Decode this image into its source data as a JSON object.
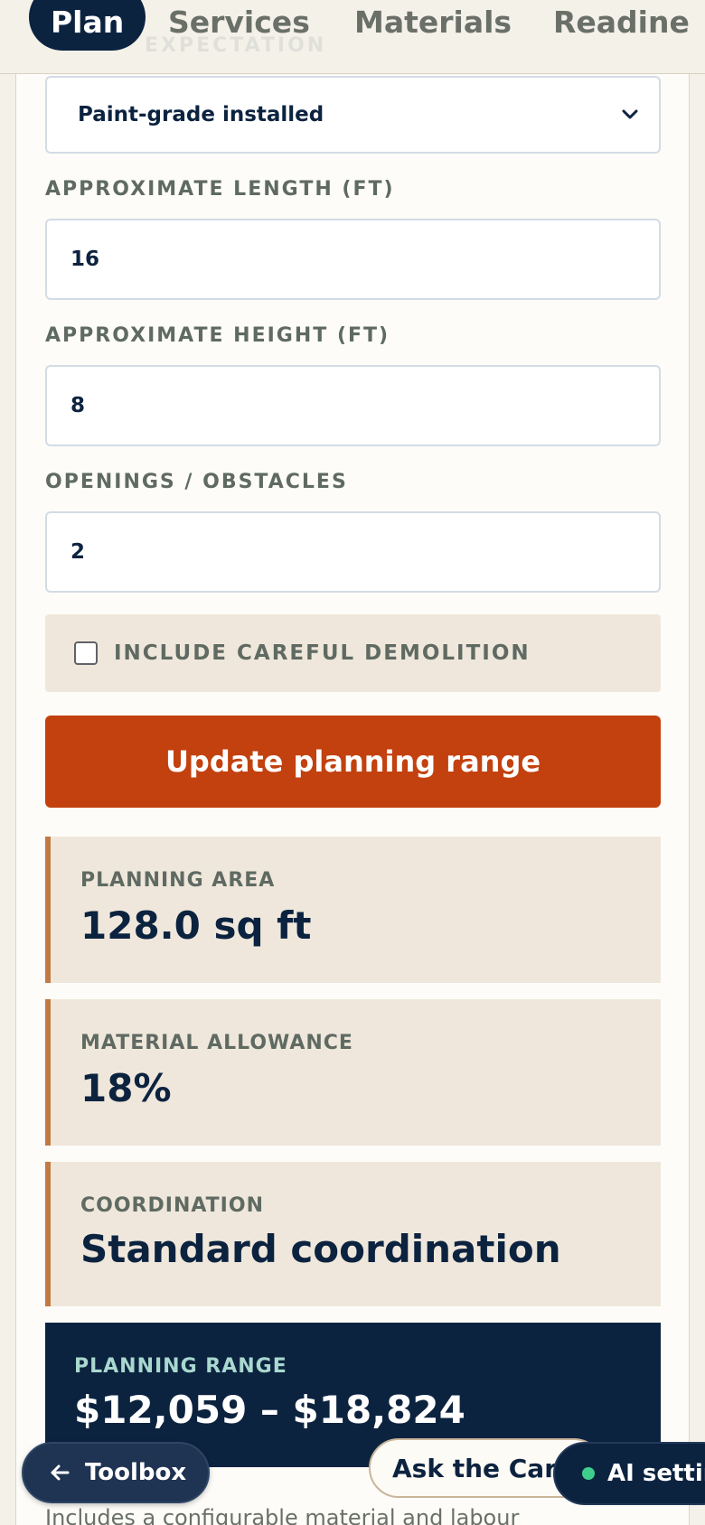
{
  "nav": {
    "tabs": [
      {
        "label": "Plan",
        "active": true
      },
      {
        "label": "Services",
        "active": false
      },
      {
        "label": "Materials",
        "active": false
      },
      {
        "label": "Readine",
        "active": false
      }
    ],
    "faded_label": "EXPECTATION"
  },
  "form": {
    "finish_select": {
      "value": "Paint-grade installed"
    },
    "length": {
      "label": "APPROXIMATE LENGTH (FT)",
      "value": "16"
    },
    "height": {
      "label": "APPROXIMATE HEIGHT (FT)",
      "value": "8"
    },
    "openings": {
      "label": "OPENINGS / OBSTACLES",
      "value": "2"
    },
    "demolition": {
      "label": "INCLUDE CAREFUL DEMOLITION",
      "checked": false
    },
    "update_button": "Update planning range"
  },
  "results": {
    "area": {
      "label": "PLANNING AREA",
      "value": "128.0 sq ft"
    },
    "allowance": {
      "label": "MATERIAL ALLOWANCE",
      "value": "18%"
    },
    "coordination": {
      "label": "COORDINATION",
      "value": "Standard coordination"
    },
    "range": {
      "label": "PLANNING RANGE",
      "value": "$12,059 – $18,824"
    }
  },
  "footnote": "Includes a configurable material and labour",
  "floating": {
    "toolbox": "Toolbox",
    "ask": "Ask the Carpenter",
    "ai_settings": "AI settings"
  },
  "colors": {
    "navy": "#0c2340",
    "accent_orange": "#c2410f",
    "card_beige": "#efe7db",
    "card_border": "#c27a44",
    "range_label": "#a9d8cf",
    "status_green": "#3ecf8e"
  }
}
